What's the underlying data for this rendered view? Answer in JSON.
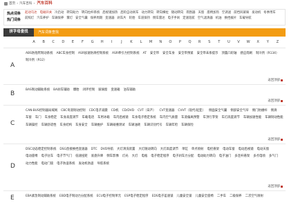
{
  "breadcrumb": {
    "home_label": "首页",
    "parent_label": "汽车百科",
    "current_label": "汽车百科"
  },
  "hot": {
    "label": "热点词条",
    "label2": "热门词条",
    "words": [
      "起动马达",
      "电磁开关",
      "冷启动",
      "转向助力",
      "转向拉杆系统",
      "后视镜加热",
      "后轮自动刹车",
      "动力转向",
      "转向横拉",
      "随动转向",
      "雨刮器",
      "天窗",
      "座椅加热",
      "空调滤",
      "前挡风玻璃",
      "发动机",
      "冬季用车",
      "前照灯",
      "汽车养护",
      "车辆保养",
      "雾灯",
      "安全气囊",
      "保养周期",
      "变速器",
      "刹车片",
      "轮胎",
      "车道保持",
      "倒车雷达",
      "电子手刹",
      "定速巡航",
      "空气滤清器",
      "机油",
      "换挡拨片",
      "车载导航"
    ]
  },
  "tabs": {
    "active": "拼字母查找",
    "other": "汽车词条查找"
  },
  "letters": [
    "A",
    "B",
    "C",
    "D",
    "E",
    "F",
    "G",
    "H",
    "I",
    "J",
    "K",
    "L",
    "M",
    "N",
    "O",
    "P",
    "Q",
    "R",
    "S",
    "T",
    "U",
    "V",
    "W",
    "X",
    "Y",
    "Z"
  ],
  "back_label": "返回顶部",
  "sections": [
    {
      "letter": "A",
      "entries": [
        "ABS防抱死制动系统",
        "ABC车身控制",
        "ASR加速防滑控制系统",
        "ASR牵引力控制系统",
        "AT",
        "安全带",
        "安全车身",
        "安全带预紧",
        "安全带未系提示",
        "顶置凸轮轴",
        "感应雨刷",
        "制冷剂（R134）",
        "制冷剂（R12）"
      ]
    },
    {
      "letter": "B",
      "entries": [
        "BAS制动辅助系统",
        "BA刹车辅助",
        "爆胎",
        "闭环控制",
        "玻璃窗",
        "变速箱",
        "泊车辅助"
      ]
    },
    {
      "letter": "C",
      "entries": [
        "CAN-BUS控制器局域网",
        "CBC弯道制动控制",
        "CDC电子减震",
        "CD机",
        "CD/DVD",
        "CVT（日产）",
        "CVT变速器",
        "CVVT（现代/起亚）",
        "侧面安全气囊",
        "侧部安全气帘",
        "侧门防撞杆",
        "侧滑",
        "车窗",
        "车门",
        "车身稳定",
        "车身高度调节",
        "车载电话",
        "车用冰箱",
        "车内后视镜",
        "车身电子稳定系统",
        "车内空气质量",
        "车道偏离预警",
        "车顶行李架",
        "车灯高度调节",
        "车辆加速性能",
        "车辆制动性能",
        "车辆操控",
        "车辆舒适性",
        "车身结构",
        "车身安全",
        "车辆维护",
        "车辆碰撞测试",
        "车辆油耗",
        "车辆识别代号",
        "车辆年检",
        "车辆保险"
      ]
    },
    {
      "letter": "D",
      "entries": [
        "DSC动态稳定控制系统",
        "DSG直接换挡变速器",
        "DTC",
        "DVD导航",
        "大灯清洗装置",
        "大灯随动转向",
        "大灯高度调节",
        "单缸",
        "单点喷射",
        "电控悬架",
        "电动车窗",
        "电动后视镜",
        "电动天窗",
        "电动座椅",
        "电子驻车",
        "电子节气门",
        "低速扭矩",
        "底盘升降",
        "倒车影像",
        "灯光",
        "大灯",
        "电瓶",
        "电子稳定程序",
        "电子刹车力分配",
        "电动助力转向",
        "电子油门",
        "多连杆悬架",
        "多点电喷",
        "多气门",
        "动力性能",
        "电动门锁",
        "电子防盗系统",
        "发动机防盗",
        "导航系统"
      ]
    },
    {
      "letter": "E",
      "entries": [
        "EBA紧急制动辅助系统",
        "EBD电子制动力分配系统",
        "ECU电子控制单元",
        "ESP电子稳定程序",
        "EDS电子差速锁",
        "儿童安全锁",
        "儿童安全座椅",
        "二手车",
        "二级保养",
        "二次空气喷射"
      ]
    }
  ]
}
